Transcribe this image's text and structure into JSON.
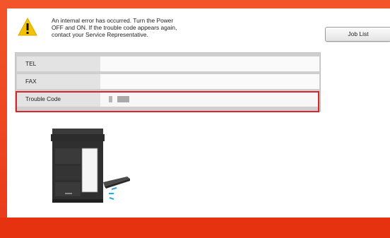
{
  "message": {
    "line1": "An internal error has occurred. Turn the Power",
    "line2": "OFF and ON.  If the trouble code appears again,",
    "line3": "contact your Service Representative."
  },
  "buttons": {
    "job_list": "Job List"
  },
  "info": {
    "tel_label": "TEL",
    "fax_label": "FAX",
    "trouble_label": "Trouble Code"
  },
  "icons": {
    "warning": "warning-triangle-icon",
    "printer": "printer-illustration"
  },
  "colors": {
    "frame_red": "#e8391a",
    "highlight_red": "#d9262b",
    "warning_yellow": "#f4c300"
  }
}
